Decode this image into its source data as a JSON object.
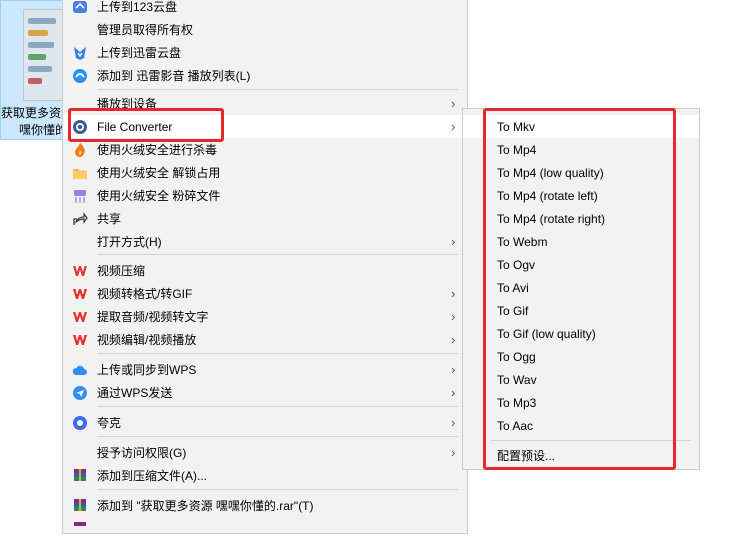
{
  "desktop_item": {
    "label_line1": "获取更多资源",
    "label_line2": "嘿你懂的"
  },
  "context_menu": {
    "items": [
      {
        "label": "上传到123云盘",
        "icon": "cloud-123-icon",
        "color": "#4d7fe8",
        "submenu": false
      },
      {
        "label": "管理员取得所有权",
        "icon": "",
        "color": "",
        "submenu": false
      },
      {
        "label": "上传到迅雷云盘",
        "icon": "thunder-bird-icon",
        "color": "#3b7de8",
        "submenu": false
      },
      {
        "label": "添加到 迅雷影音 播放列表(L)",
        "icon": "xunlei-player-icon",
        "color": "#2a8ff0",
        "submenu": false
      },
      {
        "label": "播放到设备",
        "icon": "",
        "color": "",
        "submenu": true
      },
      {
        "label": "File Converter",
        "icon": "file-converter-icon",
        "color": "#3a5d9a",
        "submenu": true
      },
      {
        "label": "使用火绒安全进行杀毒",
        "icon": "huorong-flame-icon",
        "color": "#f27a1a",
        "submenu": false
      },
      {
        "label": "使用火绒安全 解锁占用",
        "icon": "folder-unlock-icon",
        "color": "#f1b84a",
        "submenu": false
      },
      {
        "label": "使用火绒安全 粉碎文件",
        "icon": "shredder-icon",
        "color": "#8a8ad6",
        "submenu": false
      },
      {
        "label": "共享",
        "icon": "share-icon",
        "color": "#333333",
        "submenu": false
      },
      {
        "label": "打开方式(H)",
        "icon": "",
        "color": "",
        "submenu": true
      },
      {
        "label": "视频压缩",
        "icon": "wps-icon",
        "color": "#e8322b",
        "submenu": false
      },
      {
        "label": "视频转格式/转GIF",
        "icon": "wps-icon",
        "color": "#e8322b",
        "submenu": true
      },
      {
        "label": "提取音频/视频转文字",
        "icon": "wps-icon",
        "color": "#e8322b",
        "submenu": true
      },
      {
        "label": "视频编辑/视频播放",
        "icon": "wps-icon",
        "color": "#e8322b",
        "submenu": true
      },
      {
        "label": "上传或同步到WPS",
        "icon": "wps-cloud-icon",
        "color": "#2f8ff0",
        "submenu": true
      },
      {
        "label": "通过WPS发送",
        "icon": "wps-send-icon",
        "color": "#2f8ff0",
        "submenu": true
      },
      {
        "label": "夸克",
        "icon": "quark-icon",
        "color": "#3a6bf0",
        "submenu": true
      },
      {
        "label": "授予访问权限(G)",
        "icon": "",
        "color": "",
        "submenu": true
      },
      {
        "label": "添加到压缩文件(A)...",
        "icon": "winrar-icon",
        "color": "#8b2b7a",
        "submenu": false
      },
      {
        "label": "添加到 \"获取更多资源 嘿嘿你懂的.rar\"(T)",
        "icon": "winrar-icon",
        "color": "#8b2b7a",
        "submenu": false
      }
    ],
    "submenu_arrow": "›"
  },
  "submenu": {
    "items": [
      "To Mkv",
      "To Mp4",
      "To Mp4 (low quality)",
      "To Mp4 (rotate left)",
      "To Mp4 (rotate right)",
      "To Webm",
      "To Ogv",
      "To Avi",
      "To Gif",
      "To Gif (low quality)",
      "To Ogg",
      "To Wav",
      "To Mp3",
      "To Aac"
    ],
    "footer": "配置预设..."
  },
  "highlight_color": "#e8262b"
}
